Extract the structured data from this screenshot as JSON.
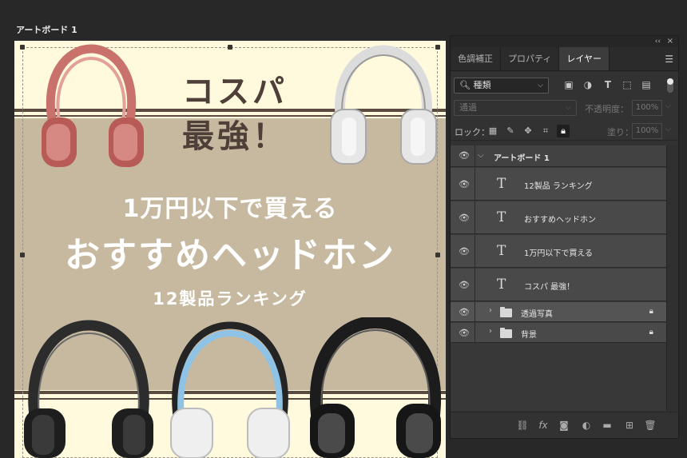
{
  "artboard": {
    "title": "アートボード 1",
    "heading_line1": "コスパ",
    "heading_line2": "最強！",
    "subtitle": "1万円以下で買える",
    "main_title": "おすすめヘッドホン",
    "ranking": "12製品ランキング"
  },
  "panel": {
    "collapse": "‹‹",
    "close": "×",
    "tabs": [
      "色調補正",
      "プロパティ",
      "レイヤー"
    ],
    "active_tab": "レイヤー",
    "filter": {
      "kind_label": "種類"
    },
    "blend_mode": "通過",
    "opacity_label": "不透明度：",
    "opacity_value": "100%",
    "lock_label": "ロック：",
    "fill_label": "塗り：",
    "fill_value": "100%",
    "layers": [
      {
        "type": "artboard",
        "name": "アートボード 1"
      },
      {
        "type": "text",
        "name": "12製品 ランキング"
      },
      {
        "type": "text",
        "name": "おすすめヘッドホン"
      },
      {
        "type": "text",
        "name": "1万円以下で買える"
      },
      {
        "type": "text",
        "name": "コスパ 最強！"
      },
      {
        "type": "group",
        "name": "透過写真",
        "locked": true
      },
      {
        "type": "group",
        "name": "背景",
        "locked": true
      }
    ]
  },
  "colors": {
    "workspace": "#282828",
    "artboard_bg": "#fff9dd",
    "band": "#c7b9a0",
    "stripe": "#5a4a40",
    "heading": "#4e4038",
    "panel_bg": "#323232",
    "layer_row": "#494949",
    "selected_group_row": "#545454"
  },
  "icons": [
    "search-icon",
    "image-filter-icon",
    "adjustment-filter-icon",
    "type-filter-icon",
    "shape-filter-icon",
    "smart-object-filter-icon",
    "lock-pixels-icon",
    "lock-brush-icon",
    "lock-position-icon",
    "lock-artboard-icon",
    "lock-all-icon",
    "eye-icon",
    "folder-icon",
    "link-icon",
    "fx-icon",
    "mask-icon",
    "adjustment-layer-icon",
    "new-group-icon",
    "new-layer-icon",
    "trash-icon"
  ]
}
